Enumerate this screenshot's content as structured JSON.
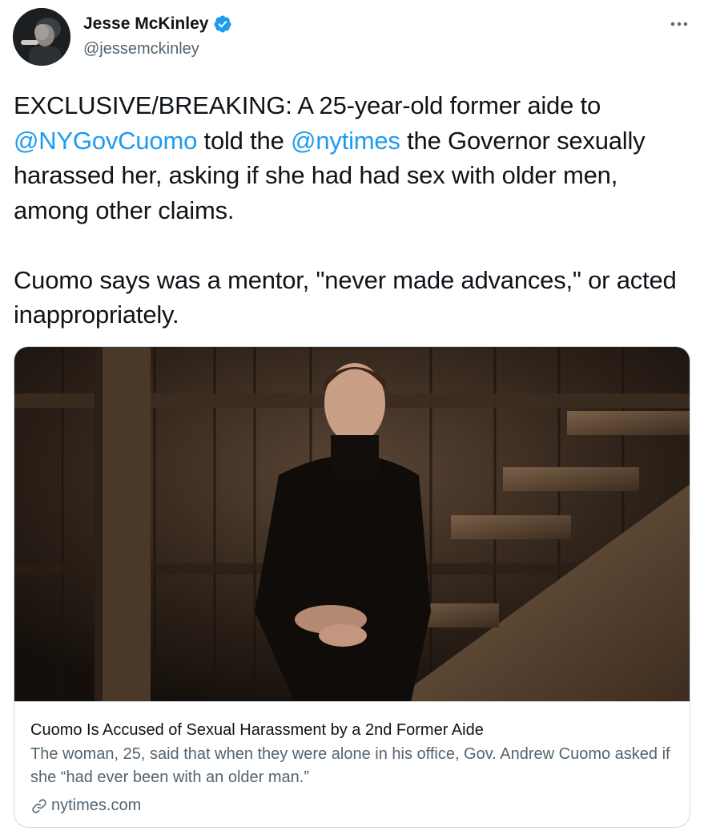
{
  "author": {
    "display_name": "Jesse McKinley",
    "handle": "@jessemckinley",
    "verified": true,
    "avatar_icon": "profile-photo"
  },
  "menu": {
    "more_icon": "more-horizontal-icon"
  },
  "tweet": {
    "para1_part1": "EXCLUSIVE/BREAKING: A 25-year-old former aide to ",
    "mention1": "@NYGovCuomo",
    "para1_part2": " told the ",
    "mention2": "@nytimes",
    "para1_part3": " the Governor sexually harassed her, asking if she had had sex with older men, among other claims.",
    "para2": "Cuomo says was a mentor, \"never made advances,\" or acted inappropriately."
  },
  "card": {
    "title": "Cuomo Is Accused of Sexual Harassment by a 2nd Former Aide",
    "description": "The woman, 25, said that when they were alone in his office, Gov. Andrew Cuomo asked if she “had ever been with an older man.”",
    "domain": "nytimes.com",
    "domain_icon": "link-icon"
  },
  "colors": {
    "link_blue": "#1d9bf0",
    "text_primary": "#0f1419",
    "text_secondary": "#536471",
    "border": "#cfd9de"
  }
}
